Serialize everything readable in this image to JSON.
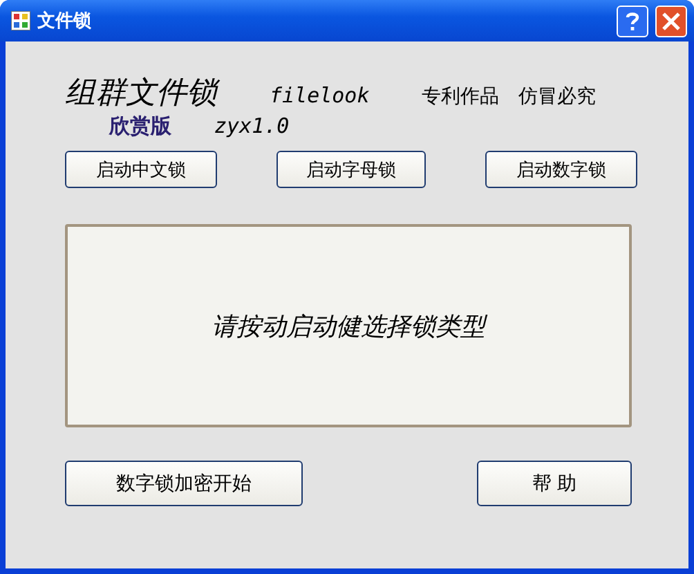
{
  "window": {
    "title": "文件锁"
  },
  "header": {
    "title": "组群文件锁",
    "name": "filelook",
    "notes": [
      "专利作品",
      "仿冒必究"
    ],
    "edition": "欣赏版",
    "version": "zyx1.0"
  },
  "lock_buttons": [
    "启动中文锁",
    "启动字母锁",
    "启动数字锁"
  ],
  "message": "请按动启动健选择锁类型",
  "bottom_buttons": [
    "数字锁加密开始",
    "帮 助"
  ]
}
